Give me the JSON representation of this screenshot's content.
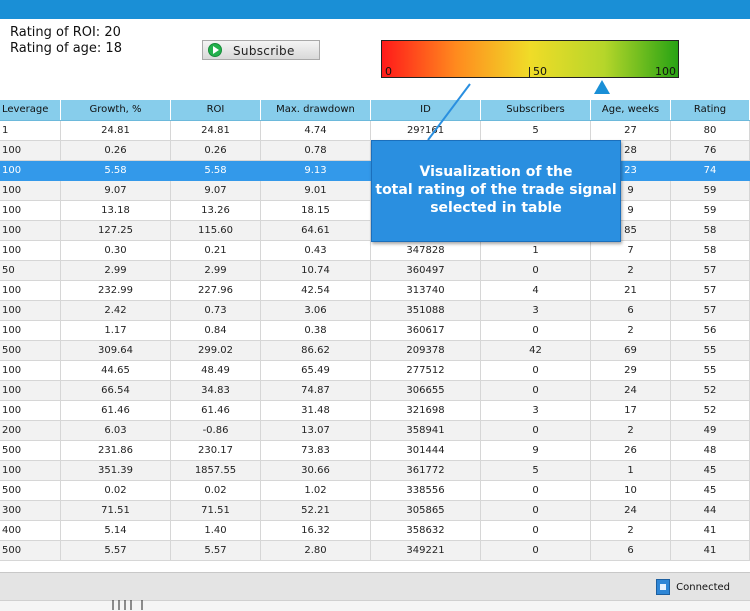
{
  "info": {
    "rating_roi": "Rating of ROI: 20",
    "rating_age": "Rating of age: 18"
  },
  "subscribe_button": "Subscribe",
  "gauge": {
    "labels": [
      "0",
      "50",
      "100"
    ],
    "value": 74,
    "min": 0,
    "max": 100
  },
  "table": {
    "columns": [
      "Leverage",
      "Growth, %",
      "ROI",
      "Max. drawdown",
      "ID",
      "Subscribers",
      "Age, weeks",
      "Rating"
    ],
    "rows": [
      [
        "1",
        "24.81",
        "24.81",
        "4.74",
        "29?161",
        "5",
        "27",
        "80"
      ],
      [
        "100",
        "0.26",
        "0.26",
        "0.78",
        "",
        "",
        "28",
        "76"
      ],
      [
        "100",
        "5.58",
        "5.58",
        "9.13",
        "",
        "",
        "23",
        "74"
      ],
      [
        "100",
        "9.07",
        "9.07",
        "9.01",
        "",
        "",
        "9",
        "59"
      ],
      [
        "100",
        "13.18",
        "13.26",
        "18.15",
        "",
        "",
        "9",
        "59"
      ],
      [
        "100",
        "127.25",
        "115.60",
        "64.61",
        "",
        "",
        "85",
        "58"
      ],
      [
        "100",
        "0.30",
        "0.21",
        "0.43",
        "347828",
        "1",
        "7",
        "58"
      ],
      [
        "50",
        "2.99",
        "2.99",
        "10.74",
        "360497",
        "0",
        "2",
        "57"
      ],
      [
        "100",
        "232.99",
        "227.96",
        "42.54",
        "313740",
        "4",
        "21",
        "57"
      ],
      [
        "100",
        "2.42",
        "0.73",
        "3.06",
        "351088",
        "3",
        "6",
        "57"
      ],
      [
        "100",
        "1.17",
        "0.84",
        "0.38",
        "360617",
        "0",
        "2",
        "56"
      ],
      [
        "500",
        "309.64",
        "299.02",
        "86.62",
        "209378",
        "42",
        "69",
        "55"
      ],
      [
        "100",
        "44.65",
        "48.49",
        "65.49",
        "277512",
        "0",
        "29",
        "55"
      ],
      [
        "100",
        "66.54",
        "34.83",
        "74.87",
        "306655",
        "0",
        "24",
        "52"
      ],
      [
        "100",
        "61.46",
        "61.46",
        "31.48",
        "321698",
        "3",
        "17",
        "52"
      ],
      [
        "200",
        "6.03",
        "-0.86",
        "13.07",
        "358941",
        "0",
        "2",
        "49"
      ],
      [
        "500",
        "231.86",
        "230.17",
        "73.83",
        "301444",
        "9",
        "26",
        "48"
      ],
      [
        "100",
        "351.39",
        "1857.55",
        "30.66",
        "361772",
        "5",
        "1",
        "45"
      ],
      [
        "500",
        "0.02",
        "0.02",
        "1.02",
        "338556",
        "0",
        "10",
        "45"
      ],
      [
        "300",
        "71.51",
        "71.51",
        "52.21",
        "305865",
        "0",
        "24",
        "44"
      ],
      [
        "400",
        "5.14",
        "1.40",
        "16.32",
        "358632",
        "0",
        "2",
        "41"
      ],
      [
        "500",
        "5.57",
        "5.57",
        "2.80",
        "349221",
        "0",
        "6",
        "41"
      ]
    ],
    "selected_index": 2
  },
  "callout": {
    "line1": "Visualization of the",
    "line2": "total rating of the trade signal",
    "line3": "selected in table"
  },
  "status": {
    "connected": "Connected"
  },
  "colors": {
    "accent": "#1a8fd6",
    "header": "#87cdeb",
    "selected_row": "#3399ea"
  }
}
